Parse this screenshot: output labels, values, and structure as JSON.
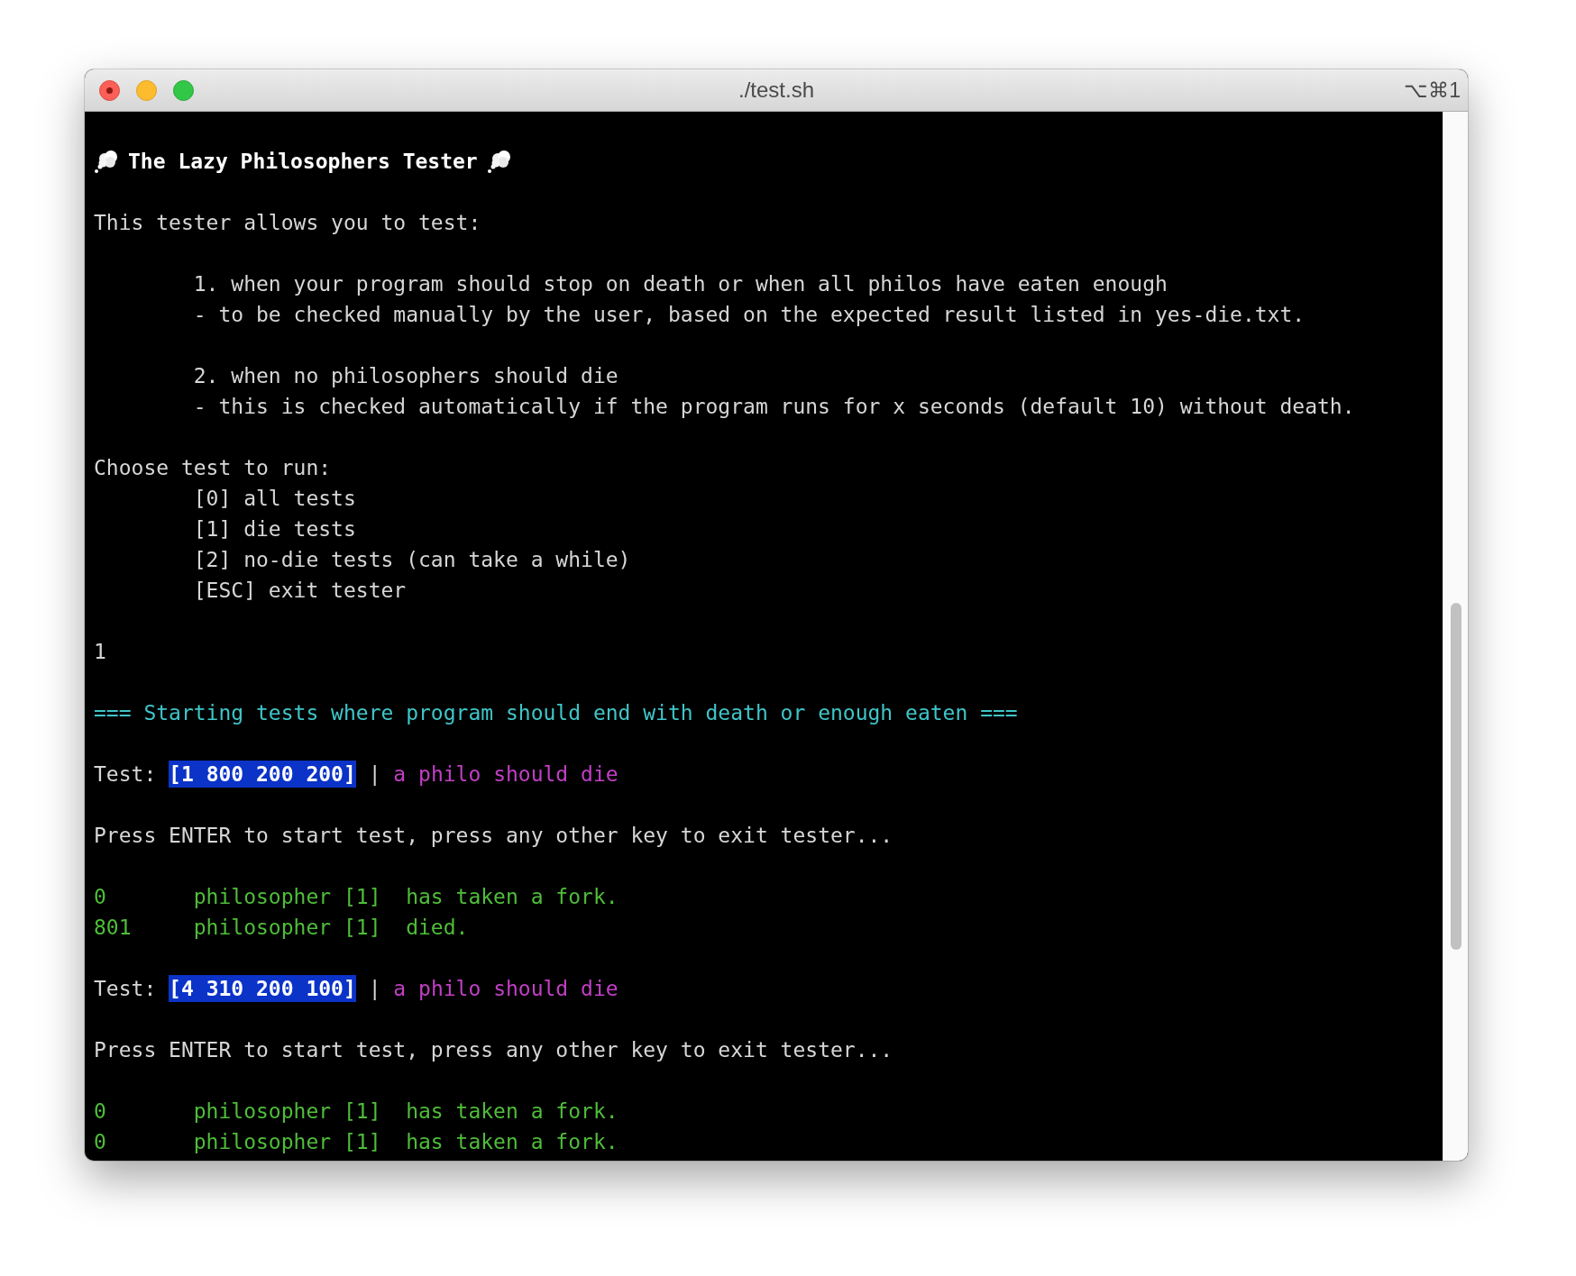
{
  "window": {
    "title": "./test.sh",
    "shortcut": "⌥⌘1"
  },
  "terminal": {
    "blocks": [
      [
        {
          "kind": "header",
          "text": "The Lazy Philosophers Tester"
        }
      ],
      [
        {
          "kind": "text",
          "indent": false,
          "text": "This tester allows you to test:"
        }
      ],
      [
        {
          "kind": "text",
          "indent": true,
          "text": "1. when your program should stop on death or when all philos have eaten enough"
        },
        {
          "kind": "text",
          "indent": true,
          "text": "- to be checked manually by the user, based on the expected result listed in yes-die.txt."
        }
      ],
      [
        {
          "kind": "text",
          "indent": true,
          "text": "2. when no philosophers should die"
        },
        {
          "kind": "text",
          "indent": true,
          "text": "- this is checked automatically if the program runs for x seconds (default 10) without death."
        }
      ],
      [
        {
          "kind": "text",
          "indent": false,
          "text": "Choose test to run:"
        },
        {
          "kind": "text",
          "indent": true,
          "text": "[0] all tests"
        },
        {
          "kind": "text",
          "indent": true,
          "text": "[1] die tests"
        },
        {
          "kind": "text",
          "indent": true,
          "text": "[2] no-die tests (can take a while)"
        },
        {
          "kind": "text",
          "indent": true,
          "text": "[ESC] exit tester"
        }
      ],
      [
        {
          "kind": "text",
          "indent": false,
          "text": "1"
        }
      ],
      [
        {
          "kind": "banner",
          "text": "=== Starting tests where program should end with death or enough eaten ==="
        }
      ],
      [
        {
          "kind": "test",
          "label": "Test:",
          "args": "[1 800 200 200]",
          "separator": "|",
          "expect": "a philo should die"
        }
      ],
      [
        {
          "kind": "text",
          "indent": false,
          "text": "Press ENTER to start test, press any other key to exit tester..."
        }
      ],
      [
        {
          "kind": "log",
          "time": "0",
          "message": "philosopher [1]  has taken a fork."
        },
        {
          "kind": "log",
          "time": "801",
          "message": "philosopher [1]  died."
        }
      ],
      [
        {
          "kind": "test",
          "label": "Test:",
          "args": "[4 310 200 100]",
          "separator": "|",
          "expect": "a philo should die"
        }
      ],
      [
        {
          "kind": "text",
          "indent": false,
          "text": "Press ENTER to start test, press any other key to exit tester..."
        }
      ],
      [
        {
          "kind": "log",
          "time": "0",
          "message": "philosopher [1]  has taken a fork."
        },
        {
          "kind": "log",
          "time": "0",
          "message": "philosopher [1]  has taken a fork."
        }
      ]
    ]
  }
}
